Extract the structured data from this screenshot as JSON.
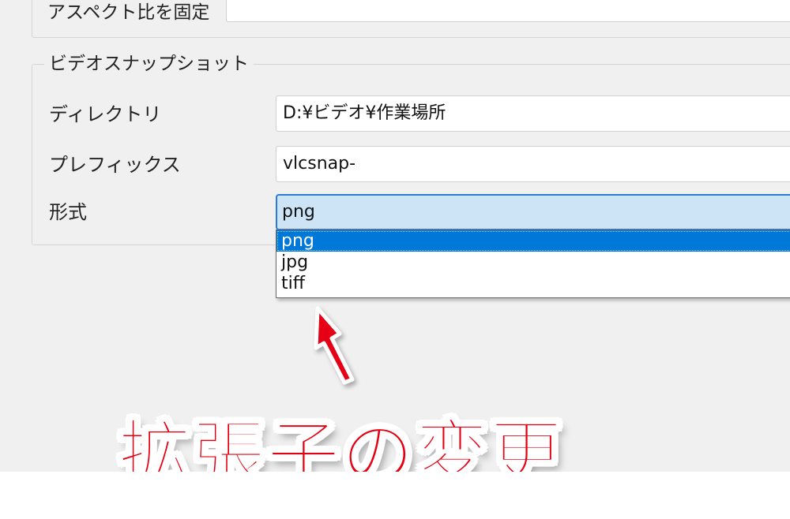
{
  "aspect_section": {
    "label": "アスペクト比を固定"
  },
  "snapshot_section": {
    "title": "ビデオスナップショット",
    "directory": {
      "label": "ディレクトリ",
      "value": "D:¥ビデオ¥作業場所"
    },
    "prefix": {
      "label": "プレフィックス",
      "value": "vlcsnap-"
    },
    "format": {
      "label": "形式",
      "value": "png",
      "options": [
        "png",
        "jpg",
        "tiff"
      ],
      "selected_index": 0
    }
  },
  "annotation": {
    "caption": "拡張子の変更",
    "color": "#e60012"
  }
}
